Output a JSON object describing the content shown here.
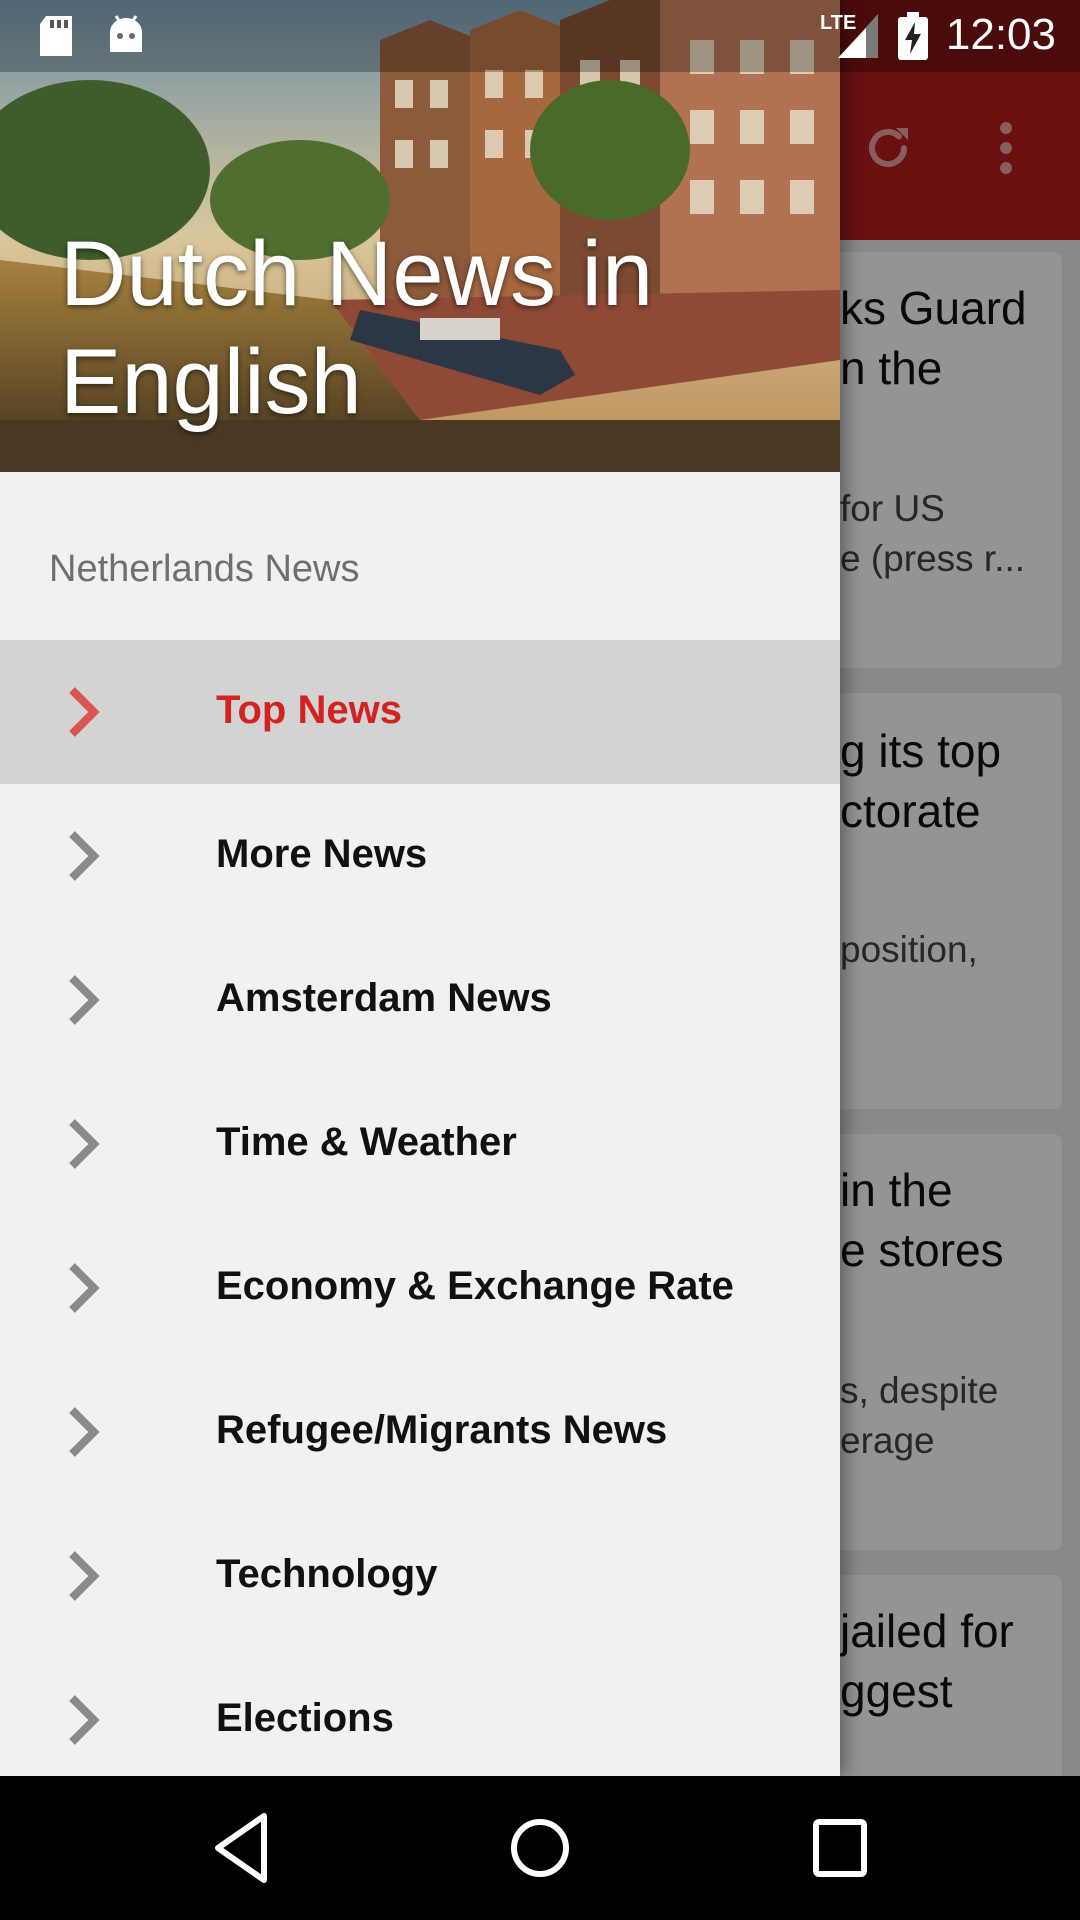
{
  "status_bar": {
    "network": "LTE",
    "time": "12:03",
    "icons": [
      "sd-card-icon",
      "android-icon",
      "lte-signal-icon",
      "battery-charging-icon"
    ]
  },
  "toolbar": {
    "icons": [
      "refresh-icon",
      "overflow-menu-icon"
    ]
  },
  "background_cards": [
    {
      "title_lines": [
        "ks Guard",
        "n the"
      ],
      "desc_lines": [
        "for US",
        "e (press r..."
      ]
    },
    {
      "title_lines": [
        "g its top",
        "ctorate"
      ],
      "desc_lines": [
        "position,"
      ]
    },
    {
      "title_lines": [
        "in the",
        "e stores"
      ],
      "desc_lines": [
        "s, despite",
        "erage"
      ]
    },
    {
      "title_lines": [
        "jailed for",
        "ggest"
      ],
      "desc_lines": []
    }
  ],
  "drawer": {
    "title": "Dutch News in English",
    "section_label": "Netherlands News",
    "items": [
      {
        "label": "Top News",
        "active": true
      },
      {
        "label": "More News",
        "active": false
      },
      {
        "label": "Amsterdam News",
        "active": false
      },
      {
        "label": "Time & Weather",
        "active": false
      },
      {
        "label": "Economy & Exchange Rate",
        "active": false
      },
      {
        "label": "Refugee/Migrants News",
        "active": false
      },
      {
        "label": "Technology",
        "active": false
      },
      {
        "label": "Elections",
        "active": false
      }
    ]
  },
  "nav_bar": {
    "icons": [
      "back-icon",
      "home-icon",
      "recents-icon"
    ]
  },
  "colors": {
    "toolbar": "#b71c1c",
    "active_item_text": "#d32222",
    "active_item_bg": "#d3d3d3",
    "drawer_bg": "#f1f1f1"
  }
}
